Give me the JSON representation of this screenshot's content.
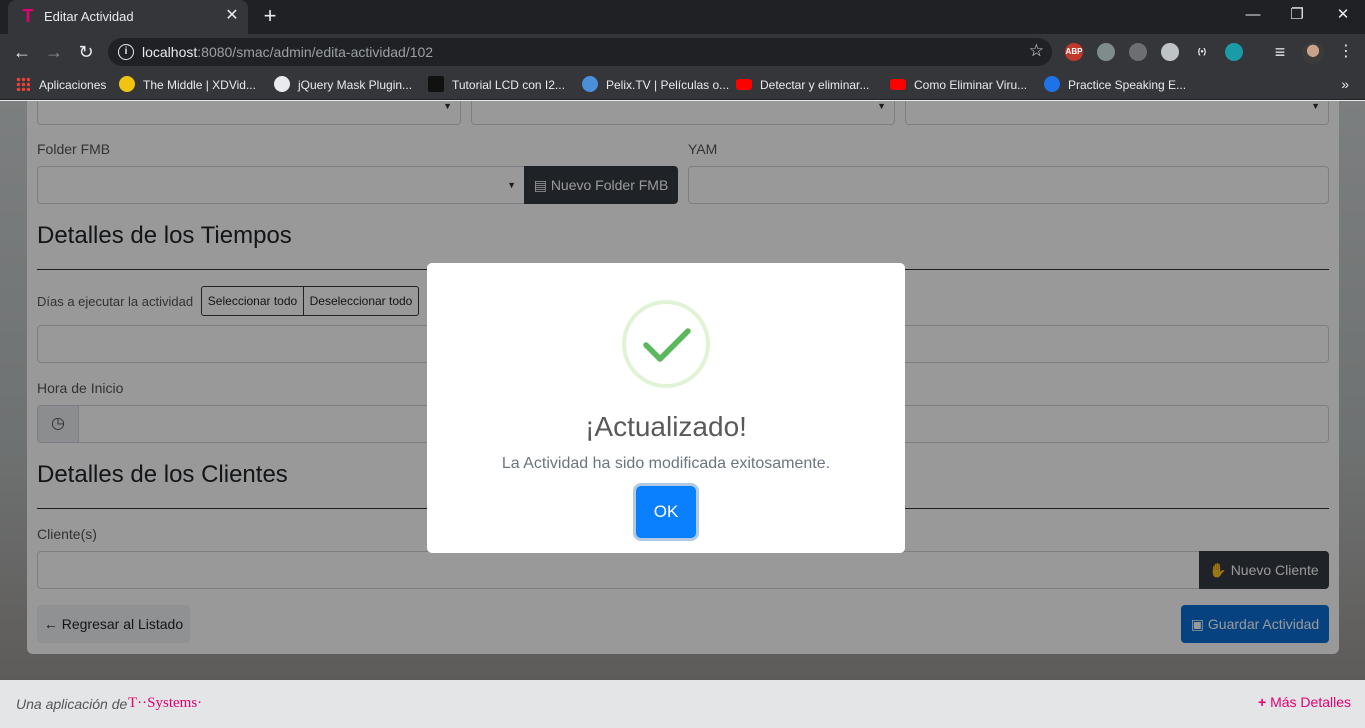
{
  "browser": {
    "tab_title": "Editar Actividad",
    "url_host": "localhost",
    "url_path": ":8080/smac/admin/edita-actividad/102",
    "bookmarks": [
      {
        "label": "Aplicaciones",
        "icon": "apps-icon"
      },
      {
        "label": "The Middle | XDVid...",
        "icon": "xd-icon"
      },
      {
        "label": "jQuery Mask Plugin...",
        "icon": "globe-icon"
      },
      {
        "label": "Tutorial LCD con I2...",
        "icon": "bird-icon"
      },
      {
        "label": "Pelix.TV | Películas o...",
        "icon": "pelix-icon"
      },
      {
        "label": "Detectar y eliminar...",
        "icon": "youtube-icon"
      },
      {
        "label": "Como Eliminar Viru...",
        "icon": "youtube-icon"
      },
      {
        "label": "Practice Speaking E...",
        "icon": "circle-icon"
      }
    ],
    "extensions": [
      {
        "name": "abp-icon",
        "text": "ABP",
        "color": "#c0392b"
      },
      {
        "name": "extension-2-icon",
        "text": "",
        "color": "#7f8c8d"
      },
      {
        "name": "extension-3-icon",
        "text": "",
        "color": "#6b6f74"
      },
      {
        "name": "extension-4-icon",
        "text": "",
        "color": "#bdc3c7"
      },
      {
        "name": "extension-5-icon",
        "text": "(•)",
        "color": "#35363a"
      },
      {
        "name": "extension-6-icon",
        "text": "",
        "color": "#1a9ba8"
      }
    ]
  },
  "form": {
    "folder_label": "Folder FMB",
    "new_folder_button": "Nuevo Folder FMB",
    "yam_label": "YAM",
    "tiempos_heading": "Detalles de los Tiempos",
    "dias_label": "Días a ejecutar la actividad",
    "select_all": "Seleccionar todo",
    "deselect_all": "Deseleccionar todo",
    "hora_label": "Hora de Inicio",
    "clientes_heading": "Detalles de los Clientes",
    "clientes_label": "Cliente(s)",
    "new_client_button": "Nuevo Cliente",
    "back_button": "Regresar al Listado",
    "save_button": "Guardar Actividad"
  },
  "footer": {
    "text": "Una aplicación de",
    "brand": "T··Systems·",
    "more": "Más Detalles"
  },
  "modal": {
    "title": "¡Actualizado!",
    "text": "La Actividad ha sido modificada exitosamente.",
    "ok": "OK",
    "accent": "#5cb85c"
  }
}
